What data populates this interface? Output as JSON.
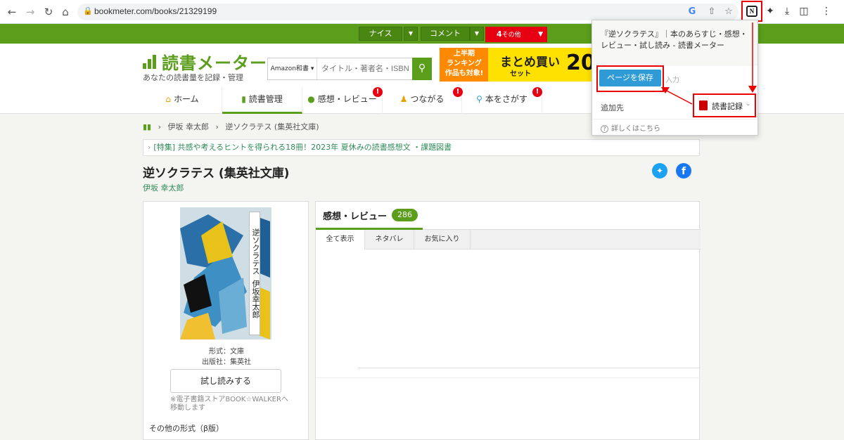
{
  "browser": {
    "url": "bookmeter.com/books/21329199"
  },
  "topbar": {
    "nice_label": "ナイス",
    "comment_label": "コメント",
    "others_count": "4",
    "others_label": "その他"
  },
  "header": {
    "logo_title": "読書メーター",
    "logo_sub": "あなたの読書量を記録・管理",
    "search_select": "Amazon和書",
    "search_placeholder": "タイトル・著者名・ISBN",
    "banner": {
      "left": "上半期\nランキング\n作品も対象!",
      "main": "まとめ買い",
      "set": "セット",
      "num": "20"
    },
    "tabs": [
      {
        "label": "ホーム"
      },
      {
        "label": "読書管理"
      },
      {
        "label": "感想・レビュー"
      },
      {
        "label": "つながる"
      },
      {
        "label": "本をさがす"
      }
    ]
  },
  "breadcrumb": {
    "author": "伊坂 幸太郎",
    "book": "逆ソクラテス (集英社文庫)"
  },
  "feature": {
    "text": "[特集] 共感や考えるヒントを得られる18冊！2023年 夏休みの読書感想文 ・課題図書"
  },
  "book": {
    "title": "逆ソクラテス (集英社文庫)",
    "author": "伊坂 幸太郎",
    "spine_text": "逆ソクラテス",
    "spine_author": "伊坂幸太郎",
    "format": "形式：文庫",
    "publisher": "出版社：集英社",
    "trial_label": "試し読みする",
    "note": "※電子書籍ストアBOOK☆WALKERへ移動します",
    "other_formats": "その他の形式（β版）"
  },
  "reviews": {
    "title": "感想・レビュー",
    "count": "286",
    "subtabs": [
      {
        "label": "全て表示"
      },
      {
        "label": "ネタバレ"
      },
      {
        "label": "お気に入り"
      }
    ]
  },
  "popup": {
    "title": "『逆ソクラテス』｜本のあらすじ・感想・レビュー・試し読み - 読書メーター",
    "save_label": "ページを保存",
    "input_label": "入力",
    "dest_label": "追加先",
    "dest_value": "読書記録",
    "help_label": "詳しくはこちら"
  },
  "colors": {
    "brand_green": "#5b9e1b",
    "alert_red": "#e60012",
    "highlight_red": "#ee0000",
    "save_blue": "#2e9bd6"
  }
}
